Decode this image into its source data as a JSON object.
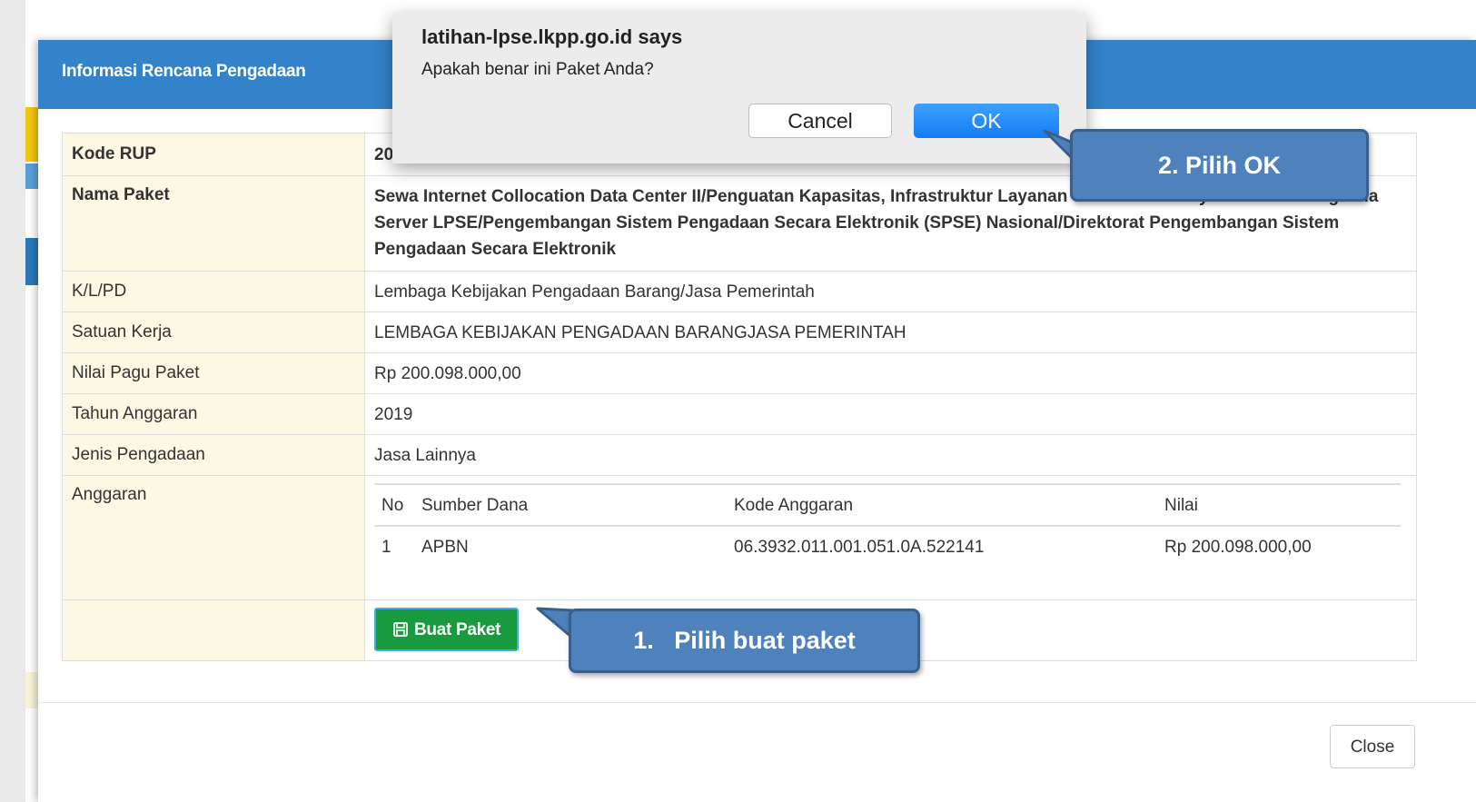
{
  "modal": {
    "title": "Informasi Rencana Pengadaan",
    "close_label": "Close"
  },
  "info": {
    "kode_rup_label": "Kode RUP",
    "kode_rup_value": "20580760",
    "nama_paket_label": "Nama Paket",
    "nama_paket_value": "Sewa Internet Collocation Data Center II/Penguatan Kapasitas, Infrastruktur Layanan dan Sumber Daya Manusia Pengelola Server LPSE/Pengembangan Sistem Pengadaan Secara Elektronik (SPSE) Nasional/Direktorat Pengembangan Sistem Pengadaan Secara Elektronik",
    "klpd_label": "K/L/PD",
    "klpd_value": "Lembaga Kebijakan Pengadaan Barang/Jasa Pemerintah",
    "satker_label": "Satuan Kerja",
    "satker_value": "LEMBAGA KEBIJAKAN PENGADAAN BARANGJASA PEMERINTAH",
    "pagu_label": "Nilai Pagu Paket",
    "pagu_value": "Rp 200.098.000,00",
    "tahun_label": "Tahun Anggaran",
    "tahun_value": "2019",
    "jenis_label": "Jenis Pengadaan",
    "jenis_value": "Jasa Lainnya",
    "anggaran_label": "Anggaran"
  },
  "anggaran": {
    "headers": {
      "no": "No",
      "sumber": "Sumber Dana",
      "kode": "Kode Anggaran",
      "nilai": "Nilai"
    },
    "rows": [
      {
        "no": "1",
        "sumber": "APBN",
        "kode": "06.3932.011.001.051.0A.522141",
        "nilai": "Rp 200.098.000,00"
      }
    ]
  },
  "buat_paket_label": "Buat Paket",
  "alert": {
    "title": "latihan-lpse.lkpp.go.id says",
    "message": "Apakah benar ini Paket Anda?",
    "cancel_label": "Cancel",
    "ok_label": "OK"
  },
  "callouts": {
    "ok": "2. Pilih OK",
    "buat": "1.   Pilih buat paket"
  },
  "colors": {
    "header_blue": "#3283c9",
    "label_bg": "#fcf8e3",
    "button_green": "#1a9a3e",
    "ok_blue": "#137cf5",
    "callout_blue": "#4f81bd"
  }
}
